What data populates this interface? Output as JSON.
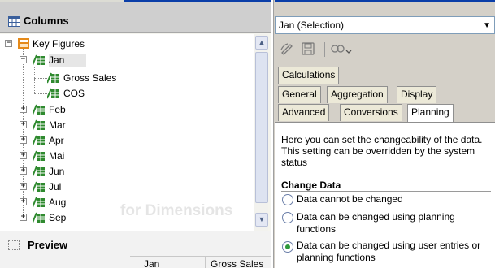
{
  "left": {
    "columns_title": "Columns",
    "tree": [
      {
        "label": "Key Figures"
      },
      {
        "label": "Jan"
      },
      {
        "label": "Gross Sales"
      },
      {
        "label": "COS"
      },
      {
        "label": "Feb"
      },
      {
        "label": "Mar"
      },
      {
        "label": "Apr"
      },
      {
        "label": "Mai"
      },
      {
        "label": "Jun"
      },
      {
        "label": "Jul"
      },
      {
        "label": "Aug"
      },
      {
        "label": "Sep"
      }
    ],
    "watermark": "for Dimensions",
    "preview_title": "Preview",
    "preview_columns": [
      "Jan",
      "Gross Sales"
    ]
  },
  "right": {
    "selection_value": "Jan (Selection)",
    "tabs_row1": [
      "Calculations"
    ],
    "tabs_row2": [
      "General",
      "Aggregation",
      "Display"
    ],
    "tabs_row3": [
      "Advanced",
      "Conversions",
      "Planning"
    ],
    "active_tab": "Planning",
    "description": "Here you can set the changeability of the data. This setting can be overridden by the system status",
    "change_data_title": "Change Data",
    "options": [
      {
        "label": "Data cannot be changed",
        "selected": false
      },
      {
        "label": "Data can be changed using planning functions",
        "selected": false
      },
      {
        "label": "Data can be changed using user entries or planning functions",
        "selected": true
      }
    ]
  },
  "colors": {
    "accent_blue": "#0a3ea8",
    "radio_selected": "#2e9a3b",
    "icon_green": "#2f8a2f",
    "key_figures_orange": "#e58a1a"
  },
  "icons": [
    "columns-icon",
    "key-figures-icon",
    "dimension-member-icon",
    "pencil-icon",
    "save-icon",
    "link-dropdown-icon",
    "preview-icon"
  ]
}
